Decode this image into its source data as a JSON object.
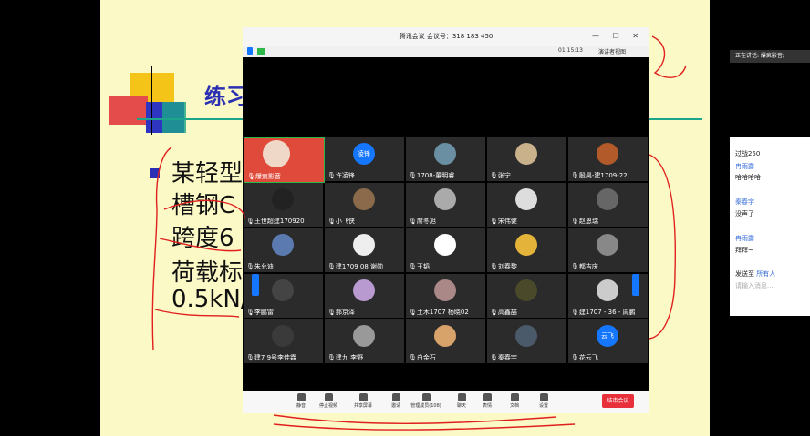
{
  "slide": {
    "title": "练习",
    "lines": [
      "某轻型",
      "槽钢C",
      "跨度6",
      "荷载标",
      "0.5kN/"
    ]
  },
  "speaking": "正在讲话: 爆疯影音;",
  "chat": {
    "messages": [
      {
        "text": "过战250"
      },
      {
        "name": "冉雨露",
        "text": "哈哈哈哈"
      },
      {
        "name": "秦春宇",
        "text": "没声了"
      },
      {
        "name": "冉雨露",
        "text": "拜拜~"
      }
    ],
    "send_label": "发送至",
    "send_target": "所有人",
    "input_placeholder": "请输入消息..."
  },
  "meeting": {
    "title": "腾讯会议 会议号：318 183 450",
    "timer": "01:15:13",
    "speaker_view": "演讲者视图",
    "participants": [
      "爆疯影音",
      "许凌锋",
      "1708-董明睿",
      "张宁",
      "殷昊-建1709-22",
      "王世超建170920",
      "小飞侠",
      "席冬旭",
      "宋伟健",
      "赵恩瑞",
      "朱允迪",
      "建1709 08 谢勋",
      "王韬",
      "刘春黎",
      "都吉庆",
      "李鹏雷",
      "郝京泽",
      "土木1707 杨晓02",
      "高鑫喆",
      "建1707 - 36 - 周鹏",
      "建7 9号李佳霖",
      "建九 李野",
      "白金石",
      "秦春宇",
      "花云飞"
    ],
    "avatar_texts": {
      "xu": "凌锋",
      "hua": "云飞"
    },
    "toolbar": [
      "静音",
      "停止视频",
      "共享屏幕",
      "邀请",
      "管理成员(108)",
      "聊天",
      "表情",
      "文档",
      "设置"
    ],
    "end_label": "结束会议"
  },
  "colors": {
    "accent": "#1577ff",
    "end": "#e8303b",
    "ink": "#e0201e",
    "slide_bg": "#fbf9c5"
  }
}
